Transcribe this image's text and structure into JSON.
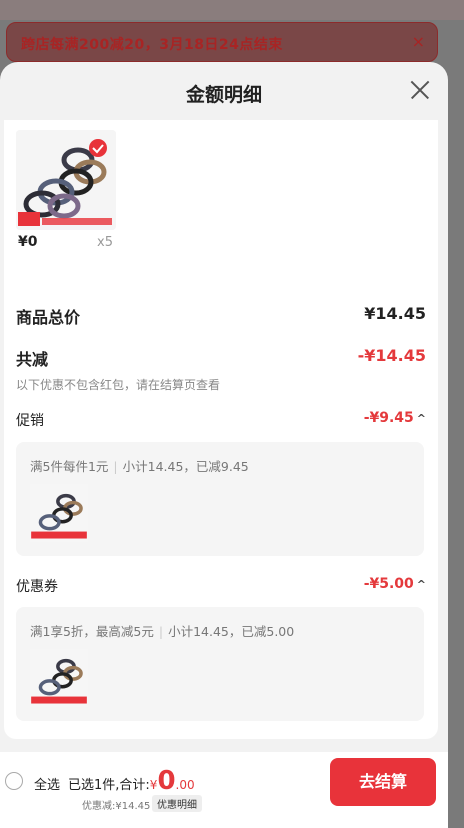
{
  "background": {
    "banner_text": "跨店每满200减20，3月18日24点结束",
    "banner_close": "×"
  },
  "sheet": {
    "title": "金额明细",
    "close_icon": "close-icon"
  },
  "product": {
    "price": "¥0",
    "qty": "x5",
    "image_icon": "hair-ties-product-image"
  },
  "summary_card": {
    "total_label": "商品总价",
    "total_value": "¥14.45",
    "discount_label": "共减",
    "discount_value": "-¥14.45",
    "discount_note": "以下优惠不包含红包，请在结算页查看",
    "promo_label": "促销",
    "promo_value": "-¥9.45",
    "promo_rule": "满5件每件1元",
    "promo_calc": "小计14.45，已减9.45",
    "coupon_label": "优惠券",
    "coupon_value": "-¥5.00",
    "coupon_rule": "满1享5折，最高减5元",
    "coupon_calc": "小计14.45，已减5.00",
    "caret": "^"
  },
  "footer": {
    "select_all": "全选",
    "selected_prefix": "已选1件,合计:",
    "currency": "¥",
    "amount_int": "0",
    "amount_dec": ".00",
    "discount_text": "优惠减:¥14.45",
    "detail_tag": "优惠明细",
    "checkout": "去结算"
  },
  "colors": {
    "accent": "#e8333a",
    "price_red": "#e4393c"
  }
}
